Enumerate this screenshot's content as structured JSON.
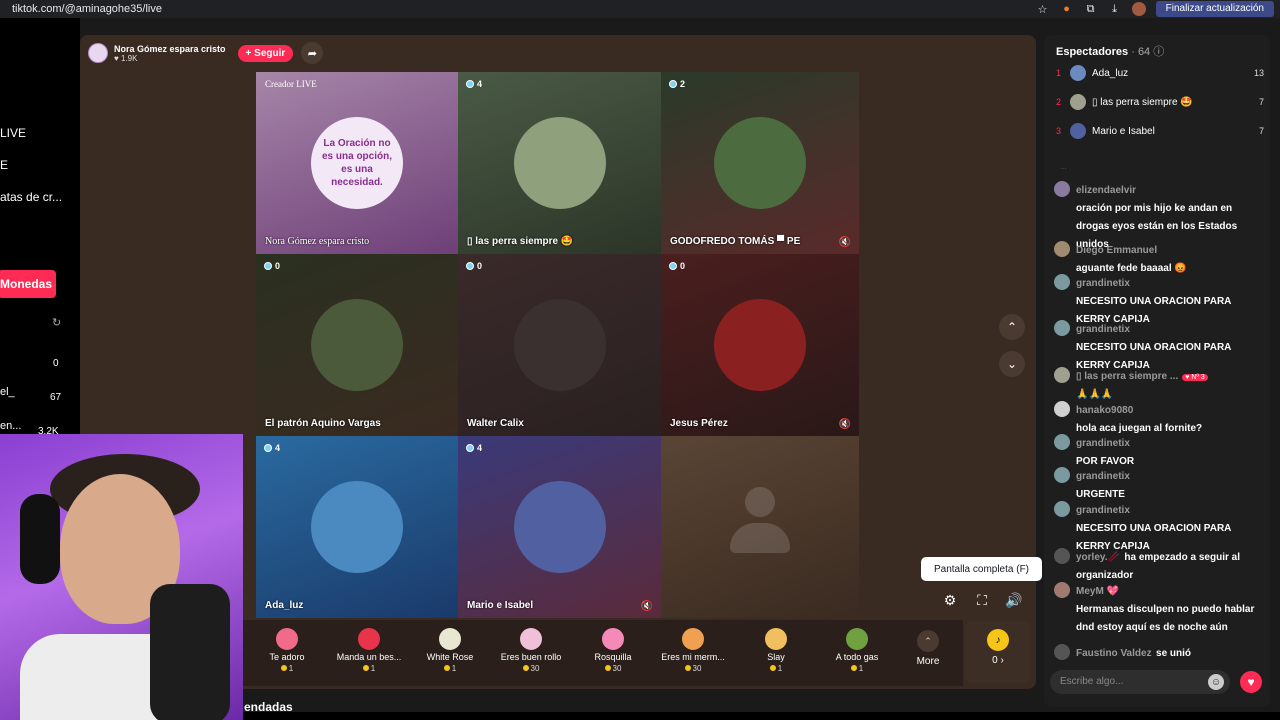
{
  "browser": {
    "url": "tiktok.com/@aminagohe35/live",
    "update_button": "Finalizar actualización",
    "icons": [
      "star-icon",
      "extension-icon",
      "puzzle-icon",
      "download-icon",
      "profile-icon",
      "menu-dots-icon"
    ]
  },
  "left_sidebar": {
    "items": [
      "LIVE",
      "E",
      "atas de cr..."
    ],
    "monedas_label": "Monedas",
    "numbers": [
      {
        "label": "",
        "value": "0"
      },
      {
        "label": "el_",
        "value": "67"
      },
      {
        "label": "en...",
        "value": "3.2K"
      }
    ]
  },
  "host": {
    "name": "Nora Gómez espara cristo",
    "likes": "♥ 1.9K",
    "follow_label": "+ Seguir"
  },
  "grid": [
    {
      "type": "creator",
      "tag": "Creador LIVE",
      "name": "Nora Gómez espara cristo",
      "poster_lines": [
        "La Oración no",
        "es una opción,",
        "es una",
        "necesidad."
      ],
      "bg": "linear-gradient(160deg,#a686a8,#6e3f78)"
    },
    {
      "type": "guest",
      "badge": "4",
      "name": "▯ las perra siempre 🤩",
      "bg": "linear-gradient(160deg,#4a5a45,#2c3528)",
      "avatar": "#8ea07c"
    },
    {
      "type": "guest",
      "badge": "2",
      "name": "GODOFREDO TOMÁS ▀ PE",
      "bg": "linear-gradient(160deg,#2a3a2a,#5a2a2a)",
      "avatar": "#4c6b3e",
      "muted": true
    },
    {
      "type": "guest",
      "badge": "0",
      "name": "El patrón Aquino Vargas",
      "bg": "linear-gradient(160deg,#2a3020,#3a2a20)",
      "avatar": "#4a5a3a"
    },
    {
      "type": "guest",
      "badge": "0",
      "name": "Walter Calix",
      "bg": "linear-gradient(160deg,#3a2a2a,#2a2020)",
      "avatar": "#3a3030"
    },
    {
      "type": "guest",
      "badge": "0",
      "name": "Jesus Pérez",
      "bg": "linear-gradient(160deg,#4a1e1e,#2a1818)",
      "avatar": "#8a2020",
      "muted": true
    },
    {
      "type": "guest",
      "badge": "4",
      "name": "Ada_luz",
      "bg": "linear-gradient(160deg,#2a6aa0,#1a3a6a)",
      "avatar": "#4a8ac0"
    },
    {
      "type": "guest",
      "badge": "4",
      "name": "Mario e Isabel",
      "bg": "linear-gradient(160deg,#3a3a7a,#5a2a3a)",
      "avatar": "#5060a0",
      "muted": true
    },
    {
      "type": "empty",
      "name": "",
      "bg": "linear-gradient(160deg,#5a4535,#3a2a20)"
    }
  ],
  "controls": {
    "tooltip": "Pantalla completa (F)",
    "settings_icon": "gear-icon",
    "fullscreen_icon": "fullscreen-icon",
    "volume_icon": "volume-icon"
  },
  "gifts": [
    {
      "name": "Te adoro",
      "price": "1",
      "color": "#f06a8a"
    },
    {
      "name": "Manda un bes...",
      "price": "1",
      "color": "#e8344a"
    },
    {
      "name": "White Rose",
      "price": "1",
      "color": "#e8e8d0"
    },
    {
      "name": "Eres buen rollo",
      "price": "30",
      "color": "#f0c0d8"
    },
    {
      "name": "Rosquilla",
      "price": "30",
      "color": "#f58ab8"
    },
    {
      "name": "Eres mi merm...",
      "price": "30",
      "color": "#f0a050"
    },
    {
      "name": "Slay",
      "price": "1",
      "color": "#f0c060"
    },
    {
      "name": "A todo gas",
      "price": "1",
      "color": "#70a040"
    }
  ],
  "more_label": "More",
  "coins_label": "0 ›",
  "below_text": "endadas",
  "chat": {
    "viewers_title": "Espectadores",
    "viewers_count": "· 64",
    "top_viewers": [
      {
        "rank": "1",
        "name": "Ada_luz",
        "score": "13",
        "color": "#6a8ac0"
      },
      {
        "rank": "2",
        "name": "▯ las perra siempre 🤩",
        "score": "7",
        "color": "#a0a090"
      },
      {
        "rank": "3",
        "name": "Mario e Isabel",
        "score": "7",
        "color": "#5060a0"
      }
    ],
    "faint": "...",
    "messages": [
      {
        "user": "elizendaelvir",
        "text": "oración por mis hijo ke andan en drogas eyos están en los Estados unidos",
        "color": "#8a7aa0"
      },
      {
        "user": "Diego Emmanuel",
        "text": "aguante fede baaaal 😡",
        "color": "#a08a70"
      },
      {
        "user": "grandinetix",
        "text": "NECESITO UNA ORACION PARA KERRY CAPIJA",
        "color": "#7a9aa0"
      },
      {
        "user": "grandinetix",
        "text": "NECESITO UNA ORACION PARA KERRY CAPIJA",
        "color": "#7a9aa0"
      },
      {
        "user": "▯ las perra siempre ...",
        "badge": "♥ Nº 3",
        "text": "🙏🙏🙏",
        "color": "#a0a090"
      },
      {
        "user": "hanako9080",
        "text": "hola aca juegan al fornite?",
        "color": "#d0d0d0"
      },
      {
        "user": "grandinetix",
        "text": "POR FAVOR",
        "color": "#7a9aa0"
      },
      {
        "user": "grandinetix",
        "text": "URGENTE",
        "color": "#7a9aa0"
      },
      {
        "user": "grandinetix",
        "text": "NECESITO UNA ORACION PARA KERRY CAPIJA",
        "color": "#7a9aa0"
      },
      {
        "user": "yorley.🥢",
        "text": "ha empezado a seguir al organizador",
        "color": "#555"
      },
      {
        "user": "MeyM 💖",
        "text": "Hermanas disculpen no puedo hablar dnd estoy aquí es de noche aún",
        "color": "#a07a70"
      },
      {
        "user": "Faustino Valdez",
        "text": "se unió",
        "color": "#555"
      }
    ],
    "input_placeholder": "Escribe algo..."
  }
}
